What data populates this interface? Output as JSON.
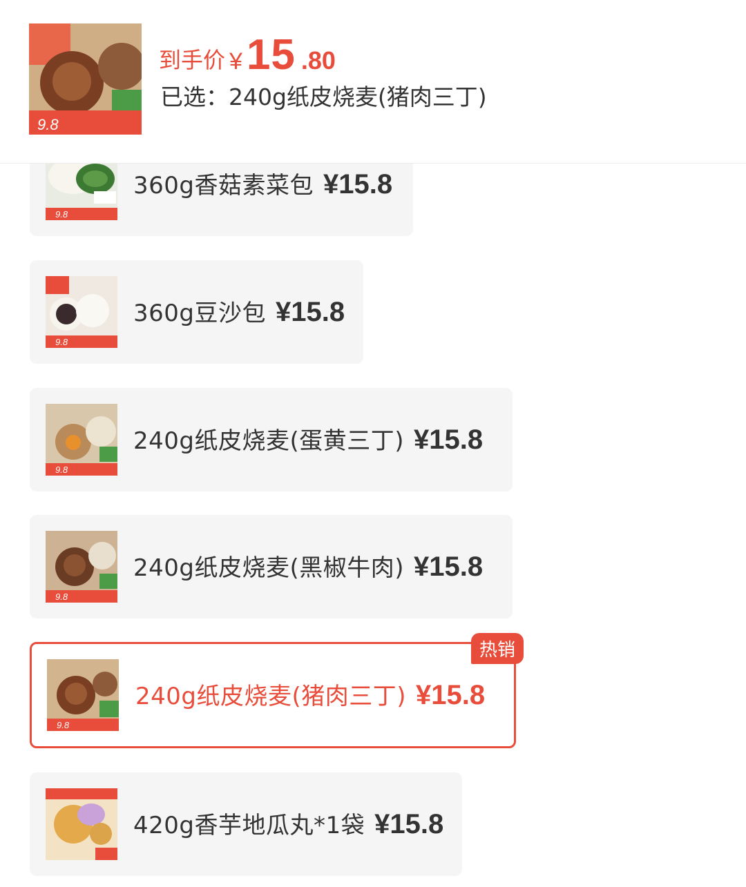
{
  "header": {
    "price_label": "到手价",
    "currency": "¥",
    "price_int": "15",
    "price_dec": ".80",
    "selected_text": "已选：240g纸皮烧麦(猪肉三丁)"
  },
  "thumb_price": "9.8",
  "options": [
    {
      "name": "360g香菇素菜包",
      "price": "¥15.8",
      "thumb": "veg-bun-image"
    },
    {
      "name": "360g豆沙包",
      "price": "¥15.8",
      "thumb": "red-bean-bun-image"
    },
    {
      "name": "240g纸皮烧麦(蛋黄三丁)",
      "price": "¥15.8",
      "thumb": "egg-yolk-shumai-image"
    },
    {
      "name": "240g纸皮烧麦(黑椒牛肉)",
      "price": "¥15.8",
      "thumb": "beef-shumai-image"
    },
    {
      "name": "240g纸皮烧麦(猪肉三丁)",
      "price": "¥15.8",
      "thumb": "pork-shumai-image",
      "badge": "热销",
      "selected": true
    },
    {
      "name": "420g香芋地瓜丸*1袋",
      "price": "¥15.8",
      "thumb": "taro-ball-image"
    }
  ],
  "colors": {
    "accent": "#e84c3a",
    "option_bg": "#f5f5f5",
    "text": "#333333"
  }
}
